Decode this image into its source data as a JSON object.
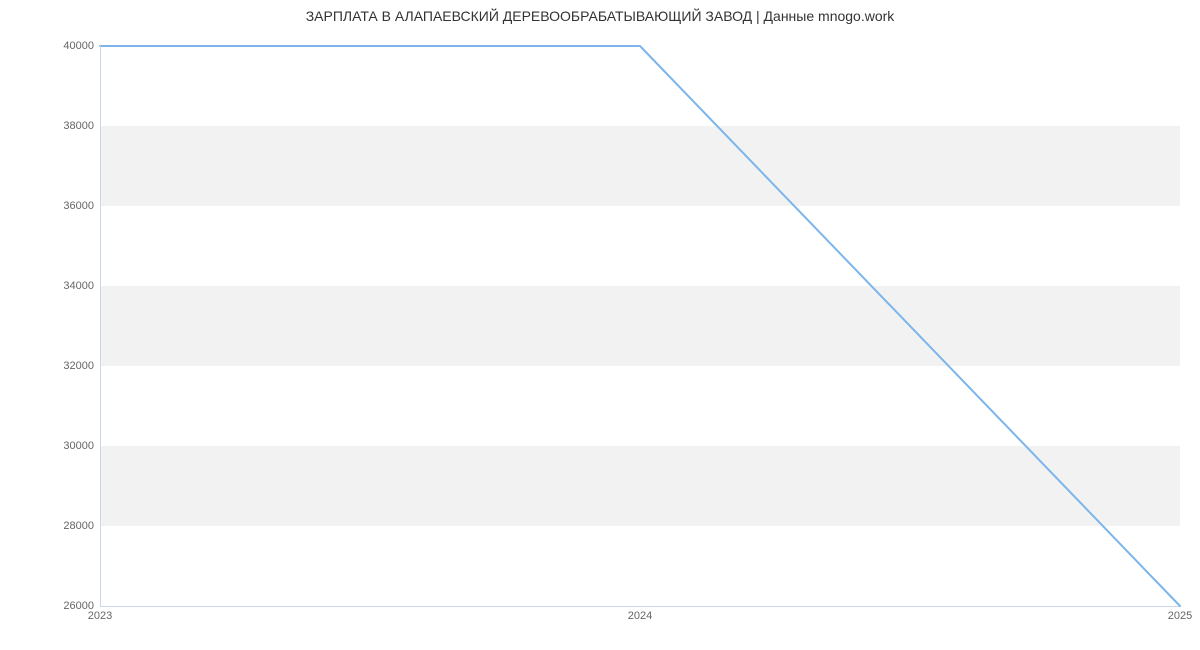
{
  "chart_data": {
    "type": "line",
    "title": "ЗАРПЛАТА В  АЛАПАЕВСКИЙ ДЕРЕВООБРАБАТЫВАЮЩИЙ ЗАВОД | Данные mnogo.work",
    "x": [
      2023,
      2024,
      2025
    ],
    "values": [
      40000,
      40000,
      26000
    ],
    "xlabel": "",
    "ylabel": "",
    "xlim": [
      2023,
      2025
    ],
    "ylim": [
      26000,
      40000
    ],
    "x_ticks": [
      2023,
      2024,
      2025
    ],
    "y_ticks": [
      26000,
      28000,
      30000,
      32000,
      34000,
      36000,
      38000,
      40000
    ],
    "line_color": "#7cb5ec",
    "band_color": "#f2f2f2"
  }
}
